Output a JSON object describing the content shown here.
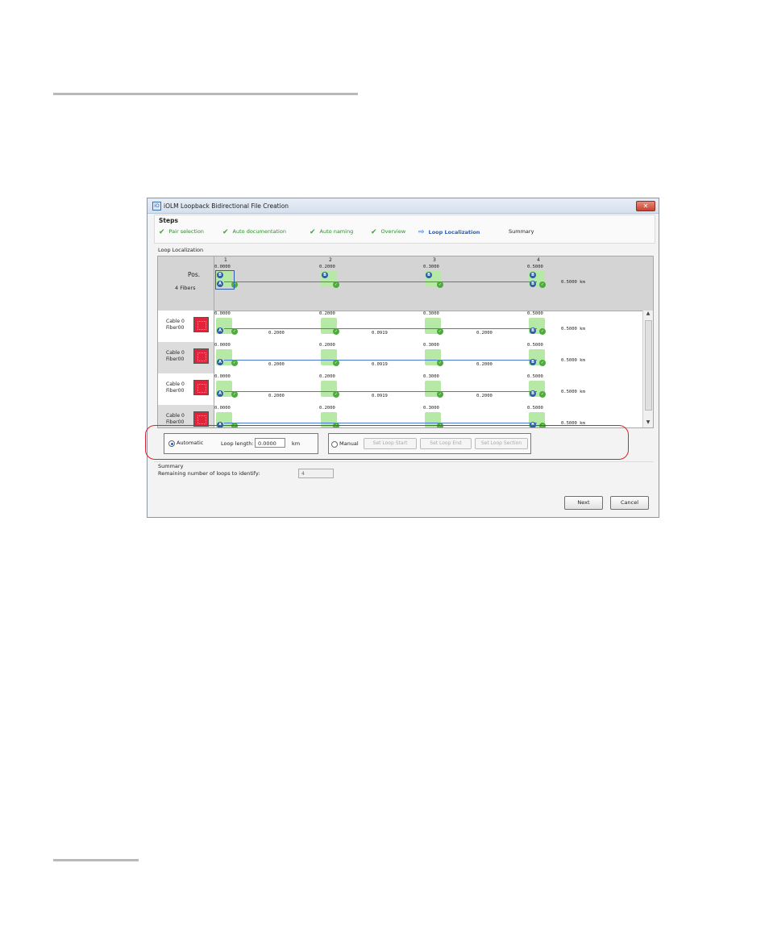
{
  "dialog": {
    "title": "iOLM Loopback Bidirectional File Creation",
    "close_glyph": "✕",
    "icon_text": "iO"
  },
  "steps": {
    "heading": "Steps",
    "items": [
      {
        "label": "Pair selection",
        "state": "done"
      },
      {
        "label": "Auto documentation",
        "state": "done"
      },
      {
        "label": "Auto naming",
        "state": "done"
      },
      {
        "label": "Overview",
        "state": "done"
      },
      {
        "label": "Loop Localization",
        "state": "active"
      },
      {
        "label": "Summary",
        "state": "pending"
      }
    ]
  },
  "loop_localization": {
    "section_label": "Loop Localization",
    "header": {
      "pos_label": "Pos.",
      "fibers_label": "4 Fibers",
      "columns": [
        "1",
        "2",
        "3",
        "4"
      ],
      "positions": [
        "0.0000",
        "0.2000",
        "0.3000",
        "0.5000"
      ],
      "total": "0.5000  km"
    },
    "rows": [
      {
        "cable": "Cable 0",
        "fiber": "Fiber00",
        "positions": [
          "0.0000",
          "0.2000",
          "0.3000",
          "0.5000"
        ],
        "spans": [
          "0.2000",
          "0.0919",
          "0.2000"
        ],
        "total": "0.5000  km"
      },
      {
        "cable": "Cable 0",
        "fiber": "Fiber00",
        "positions": [
          "0.0000",
          "0.2000",
          "0.3000",
          "0.5000"
        ],
        "spans": [
          "0.2000",
          "0.0919",
          "0.2000"
        ],
        "total": "0.5000  km"
      },
      {
        "cable": "Cable 0",
        "fiber": "Fiber00",
        "positions": [
          "0.0000",
          "0.2000",
          "0.3000",
          "0.5000"
        ],
        "spans": [
          "0.2000",
          "0.0919",
          "0.2000"
        ],
        "total": "0.5000  km"
      },
      {
        "cable": "Cable 0",
        "fiber": "Fiber00",
        "positions": [
          "0.0000",
          "0.2000",
          "0.3000",
          "0.5000"
        ],
        "spans": [],
        "total": "0.5000  km"
      }
    ],
    "markers": {
      "a": "A",
      "b": "B",
      "check": "✓"
    }
  },
  "mode": {
    "automatic_label": "Automatic",
    "loop_length_label": "Loop length:",
    "loop_length_value": "0.0000",
    "unit": "km",
    "manual_label": "Manual",
    "buttons": [
      "Set Loop Start",
      "Set Loop End",
      "Set Loop Section"
    ]
  },
  "summary": {
    "title": "Summary",
    "remaining_label": "Remaining number of loops to identify:",
    "remaining_value": "4"
  },
  "footer": {
    "next_label": "Next",
    "cancel_label": "Cancel"
  },
  "scroll": {
    "up": "▲",
    "down": "▼"
  },
  "icons": {
    "check": "✔",
    "arrow": "⇨"
  }
}
